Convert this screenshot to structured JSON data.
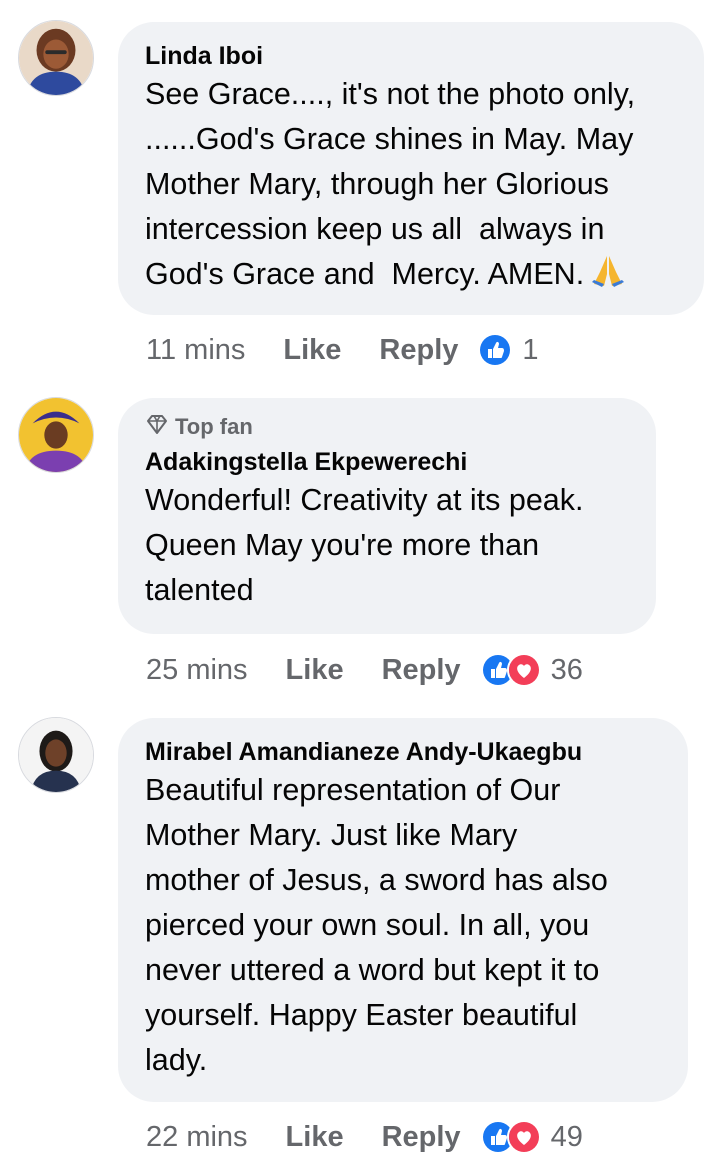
{
  "comments": [
    {
      "author": "Linda Iboi",
      "text": "See Grace...., it's not the photo only,\n......God's Grace shines in May. May\nMother Mary, through her Glorious\nintercession keep us all  always in\nGod's Grace and  Mercy. AMEN.",
      "emoji_icon": "praying-hands-icon",
      "time": "11 mins",
      "like_label": "Like",
      "reply_label": "Reply",
      "reactions": [
        "like"
      ],
      "reaction_count": "1"
    },
    {
      "badge": "Top fan",
      "badge_icon": "diamond-icon",
      "author": "Adakingstella Ekpewerechi",
      "text": "Wonderful! Creativity at its peak.\nQueen May you're more than\ntalented",
      "time": "25 mins",
      "like_label": "Like",
      "reply_label": "Reply",
      "reactions": [
        "like",
        "love"
      ],
      "reaction_count": "36"
    },
    {
      "author": "Mirabel Amandianeze Andy-Ukaegbu",
      "text": "Beautiful representation of Our\nMother Mary. Just like Mary\nmother of Jesus, a sword has also\npierced your own soul. In all, you\nnever uttered a word but kept it to\nyourself. Happy Easter beautiful\nlady.",
      "time": "22 mins",
      "like_label": "Like",
      "reply_label": "Reply",
      "reactions": [
        "like",
        "love"
      ],
      "reaction_count": "49"
    }
  ],
  "colors": {
    "bubble": "#f0f2f5",
    "secondary_text": "#65676b",
    "like_blue": "#1877f2",
    "love_red": "#f33e58"
  }
}
